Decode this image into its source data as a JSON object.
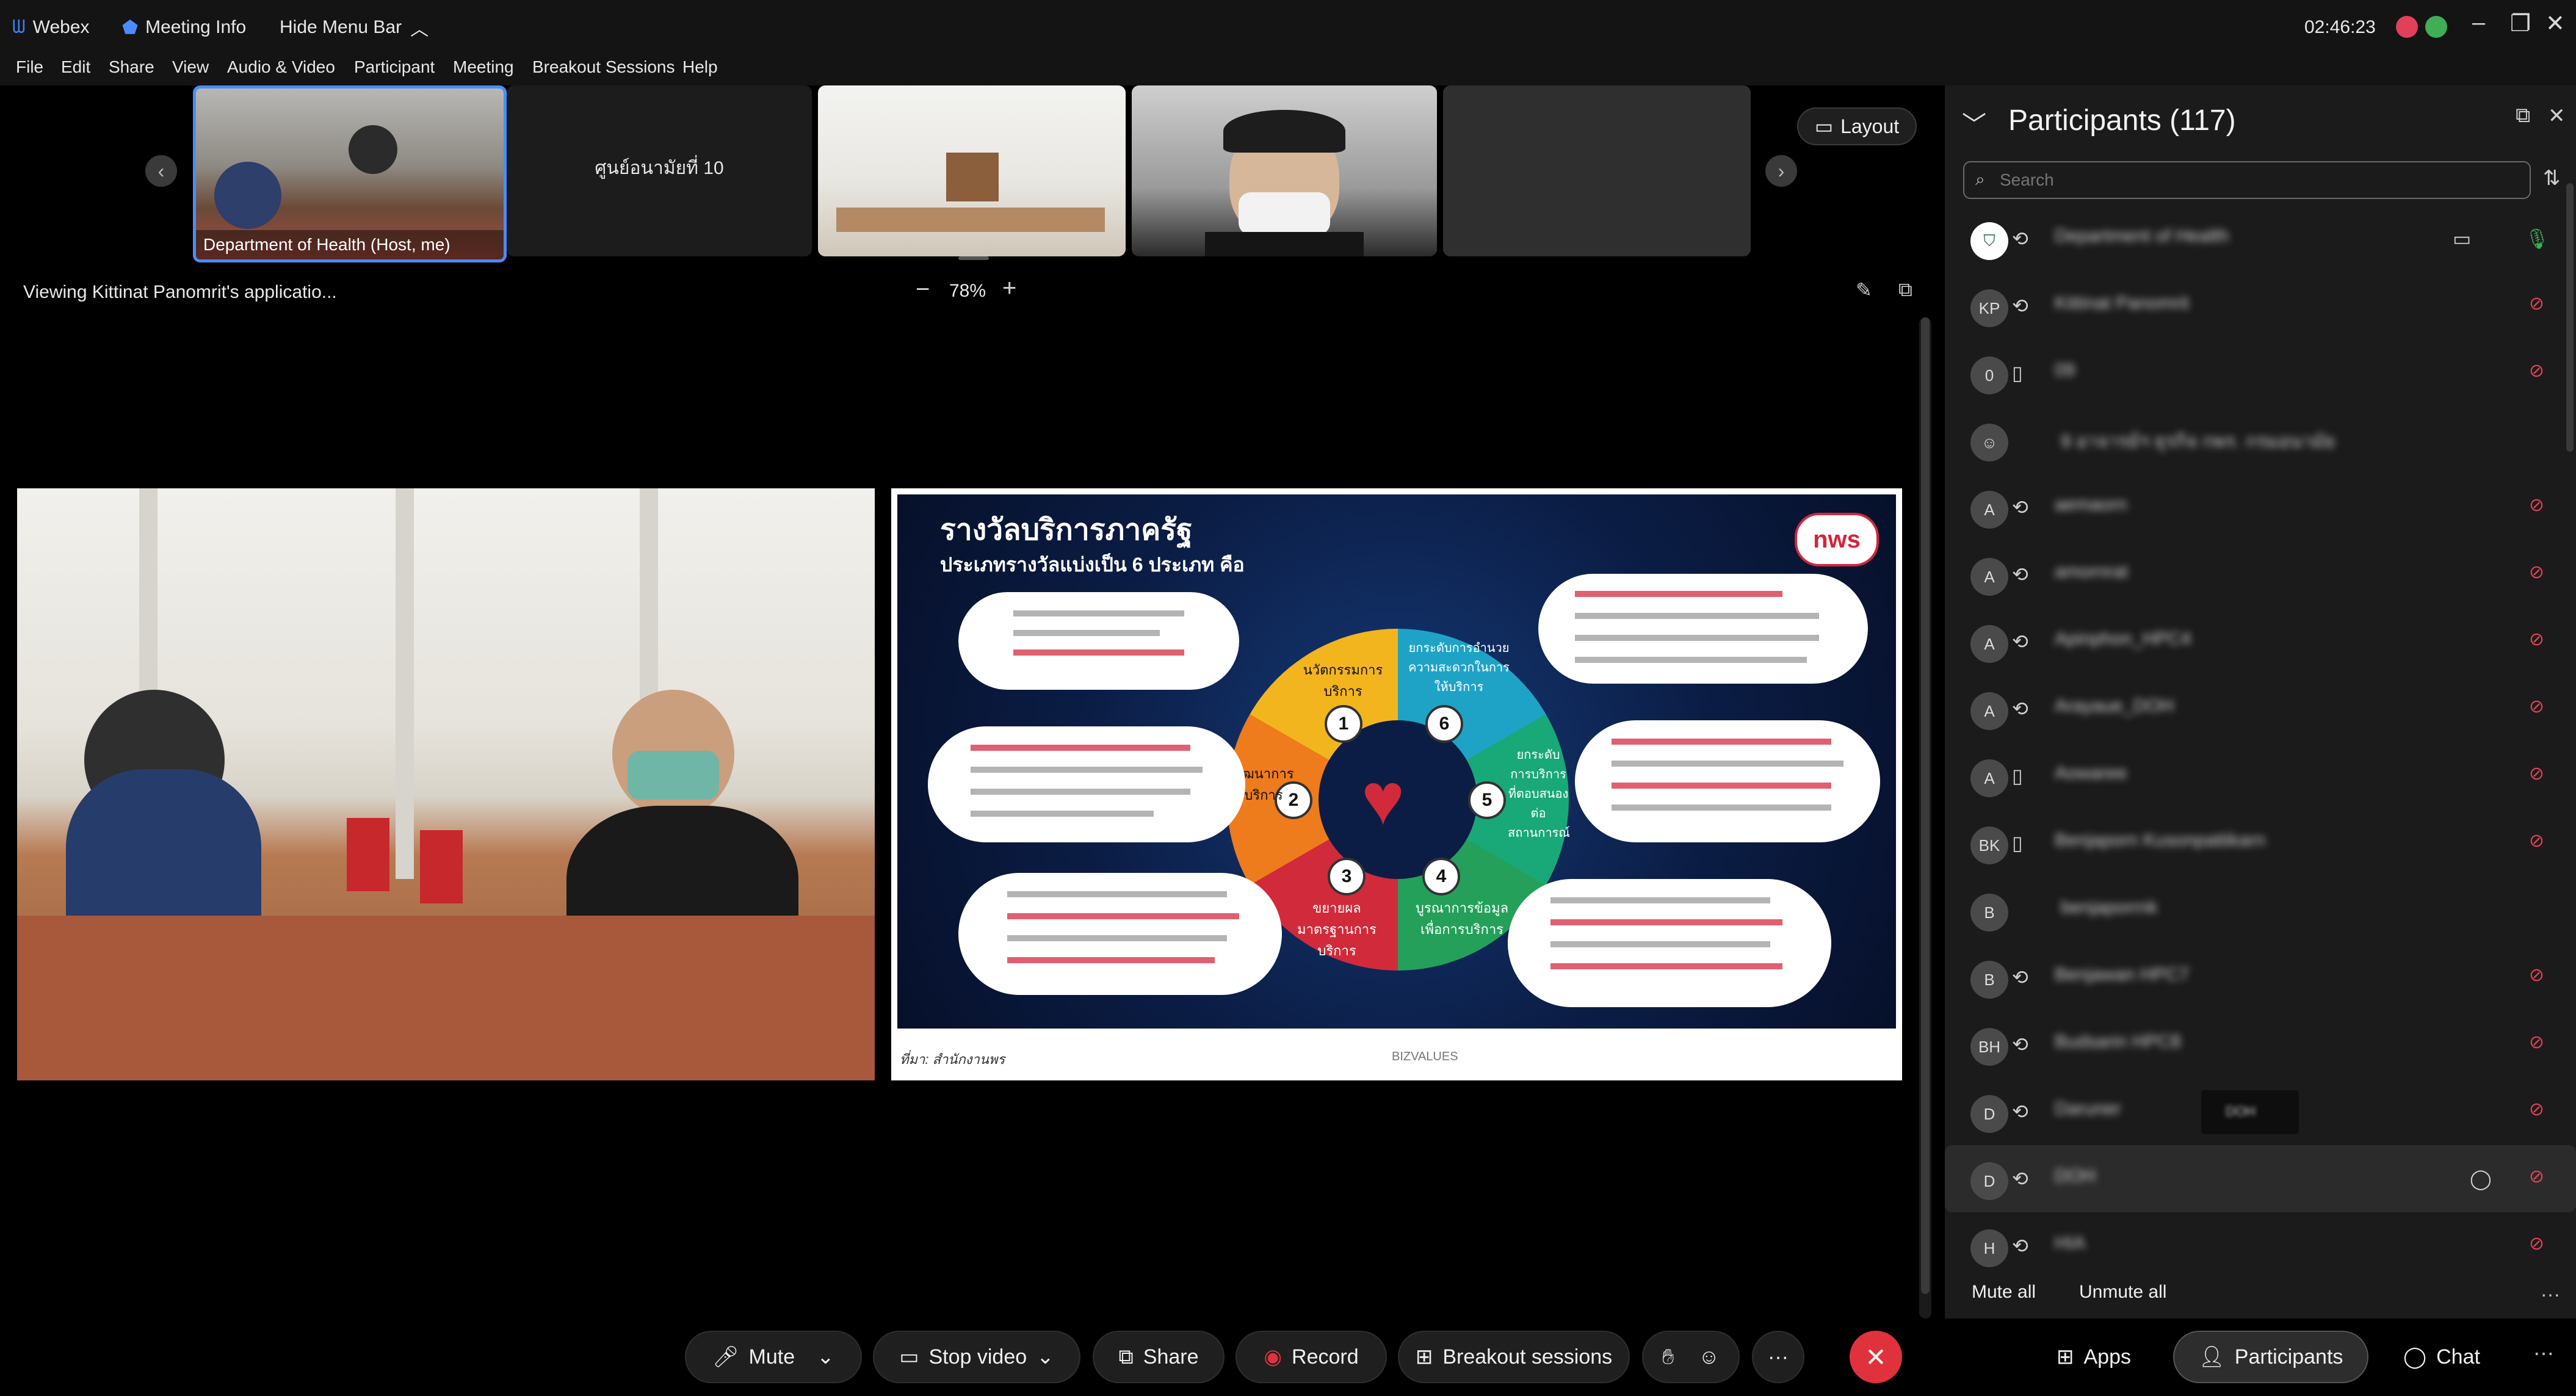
{
  "topbar": {
    "app_name": "Webex",
    "meeting_info": "Meeting Info",
    "hide_menu_bar": "Hide Menu Bar",
    "timer": "02:46:23"
  },
  "menu": [
    "File",
    "Edit",
    "Share",
    "View",
    "Audio & Video",
    "Participant",
    "Meeting",
    "Breakout Sessions",
    "Help"
  ],
  "filmstrip": {
    "thumb1_label": "Department of Health (Host, me)",
    "thumb2_label": "ศูนย์อนามัยที่ 10"
  },
  "layout_label": "Layout",
  "viewing": "Viewing Kittinat Panomrit's applicatio...",
  "zoom": "78%",
  "zoom_minus": "−",
  "zoom_plus": "+",
  "slide": {
    "title": "รางวัลบริการภาครัฐ",
    "subtitle": "ประเภทรางวัลแบ่งเป็น 6 ประเภท คือ",
    "logo": "nws",
    "source": "ที่มา: สำนักงานพร",
    "footer_brand": "BIZVALUES",
    "categories": [
      {
        "num": "1",
        "label": "นวัตกรรมการบริการ"
      },
      {
        "num": "2",
        "label": "พัฒนาการบริการ"
      },
      {
        "num": "3",
        "label": "ขยายผลมาตรฐานการบริการ"
      },
      {
        "num": "4",
        "label": "บูรณาการข้อมูลเพื่อการบริการ"
      },
      {
        "num": "5",
        "label": "ยกระดับการบริการที่ตอบสนองต่อสถานการณ์"
      },
      {
        "num": "6",
        "label": "ยกระดับการอำนวยความสะดวกในการให้บริการ"
      }
    ]
  },
  "participants": {
    "title": "Participants (117)",
    "search_placeholder": "Search",
    "list": [
      {
        "initials": "",
        "name": "Department of Health",
        "sub": "Host, me"
      },
      {
        "initials": "KP",
        "name": "Kittinat Panomrit"
      },
      {
        "initials": "0",
        "name": "09"
      },
      {
        "initials": "",
        "name": "9 อาจารย์ฯ ธุรกิจ กพร. กรมอนามัย"
      },
      {
        "initials": "A",
        "name": "aemaorn"
      },
      {
        "initials": "A",
        "name": "amornrat"
      },
      {
        "initials": "A",
        "name": "Apinphon_HPC4"
      },
      {
        "initials": "A",
        "name": "Arayaue_DOH"
      },
      {
        "initials": "A",
        "name": "Aowaree"
      },
      {
        "initials": "BK",
        "name": "Benjaporn Kusonpattikarn"
      },
      {
        "initials": "B",
        "name": "benjaporrnk"
      },
      {
        "initials": "B",
        "name": "Benjawan HPC7"
      },
      {
        "initials": "BH",
        "name": "Budsarin HPC8"
      },
      {
        "initials": "D",
        "name": "Daruner",
        "tag": "DOH"
      },
      {
        "initials": "D",
        "name": "DOH"
      },
      {
        "initials": "H",
        "name": "HIA"
      }
    ],
    "mute_all": "Mute all",
    "unmute_all": "Unmute all"
  },
  "toolbar": {
    "mute": "Mute",
    "stop_video": "Stop video",
    "share": "Share",
    "record": "Record",
    "breakout": "Breakout sessions",
    "more": "···",
    "apps": "Apps",
    "participants": "Participants",
    "chat": "Chat"
  },
  "colors": {
    "accent_blue": "#4a8cff",
    "end_red": "#e0323d",
    "muted_red": "#e0405a"
  }
}
